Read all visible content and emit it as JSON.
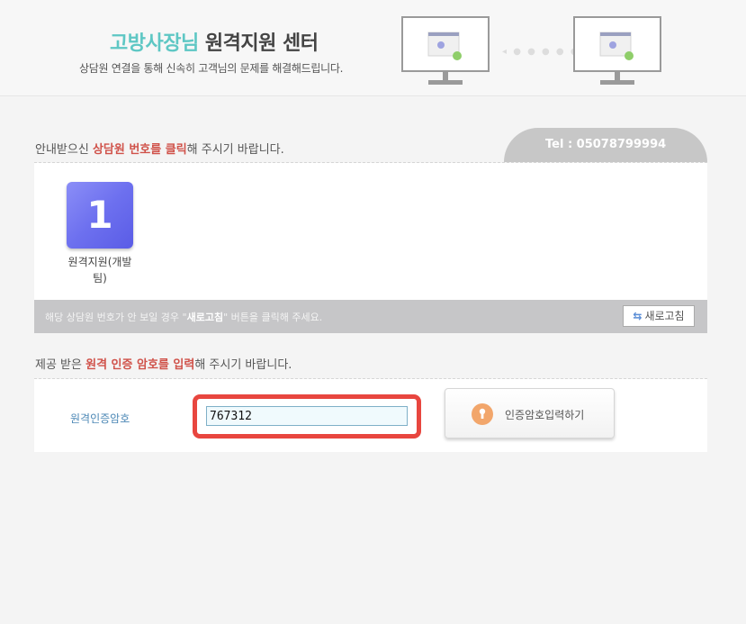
{
  "header": {
    "brand": "고방사장님",
    "title_rest": " 원격지원 센터",
    "subtitle": "상담원 연결을 통해 신속히 고객님의 문제를 해결해드립니다."
  },
  "section1": {
    "prefix": "안내받으신 ",
    "highlight": "상담원 번호를 클릭",
    "suffix": "해 주시기 바랍니다."
  },
  "tel": "Tel : 05078799994",
  "agents": [
    {
      "number": "1",
      "label": "원격지원(개발팀)"
    }
  ],
  "notice": {
    "prefix": "해당 상담원 번호가 안 보일 경우 \"",
    "bold": "새로고침",
    "suffix": "\" 버튼을 클릭해 주세요."
  },
  "refresh_button": {
    "label": "새로고침",
    "icon": "refresh-icon"
  },
  "section2": {
    "prefix": "제공 받은 ",
    "highlight": "원격 인증 암호를 입력",
    "suffix": "해 주시기 바랍니다."
  },
  "auth": {
    "label": "원격인증암호",
    "value": "767312",
    "submit_label": "인증암호입력하기",
    "submit_icon": "keyhole-icon"
  },
  "colors": {
    "brand": "#5ec7c4",
    "highlight": "#d0524a",
    "input_frame": "#e8463f",
    "agent_tile": "#6d70ef",
    "tel_tab": "#c7c7c7"
  }
}
